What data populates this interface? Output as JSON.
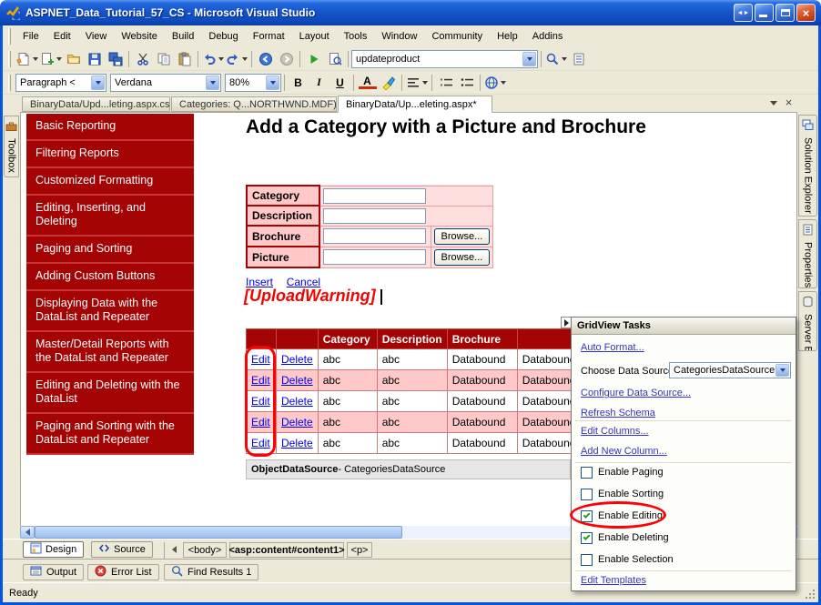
{
  "window": {
    "title": "ASPNET_Data_Tutorial_57_CS - Microsoft Visual Studio",
    "status": "Ready"
  },
  "icons": {
    "close": "×",
    "window_arrows": "◄►"
  },
  "menu": {
    "items": [
      "File",
      "Edit",
      "View",
      "Website",
      "Build",
      "Debug",
      "Format",
      "Layout",
      "Tools",
      "Window",
      "Community",
      "Help",
      "Addins"
    ]
  },
  "toolbars": {
    "address_combo": "updateproduct",
    "format_combo": "Paragraph <",
    "font_combo": "Verdana",
    "zoom_combo": "80%",
    "bold_label": "B",
    "italic_label": "I",
    "underline_label": "U",
    "fontcolor_label": "A"
  },
  "doc_tabs": {
    "tabs": [
      {
        "label": "BinaryData/Upd...leting.aspx.cs"
      },
      {
        "label": "Categories: Q...NORTHWND.MDF)"
      },
      {
        "label": "BinaryData/Up...eleting.aspx*"
      }
    ]
  },
  "side_tabs": {
    "left": "Toolbox",
    "right": [
      "Solution Explorer",
      "Properties",
      "Server E..."
    ]
  },
  "sidebar": {
    "items": [
      "Basic Reporting",
      "Filtering Reports",
      "Customized Formatting",
      "Editing, Inserting, and Deleting",
      "Paging and Sorting",
      "Adding Custom Buttons",
      "Displaying Data with the DataList and Repeater",
      "Master/Detail Reports with the DataList and Repeater",
      "Editing and Deleting with the DataList",
      "Paging and Sorting with the DataList and Repeater"
    ]
  },
  "content": {
    "heading": "Add a Category with a Picture and Brochure",
    "form": {
      "rows": [
        {
          "label": "Category"
        },
        {
          "label": "Description"
        },
        {
          "label": "Brochure"
        },
        {
          "label": "Picture"
        }
      ],
      "browse_button": "Browse..."
    },
    "insert_link": "Insert",
    "cancel_link": "Cancel",
    "upload_warning": "[UploadWarning]",
    "grid": {
      "headers": [
        "",
        "",
        "Category",
        "Description",
        "Brochure",
        ""
      ],
      "rows": [
        [
          "Edit",
          "Delete",
          "abc",
          "abc",
          "Databound",
          "Databound"
        ],
        [
          "Edit",
          "Delete",
          "abc",
          "abc",
          "Databound",
          "Databound"
        ],
        [
          "Edit",
          "Delete",
          "abc",
          "abc",
          "Databound",
          "Databound"
        ],
        [
          "Edit",
          "Delete",
          "abc",
          "abc",
          "Databound",
          "Databound"
        ],
        [
          "Edit",
          "Delete",
          "abc",
          "abc",
          "Databound",
          "Databound"
        ]
      ]
    },
    "datasource": {
      "name": "ObjectDataSource",
      "suffix": " - CategoriesDataSource"
    }
  },
  "tasks": {
    "title": "GridView Tasks",
    "auto_format": "Auto Format...",
    "choose_label": "Choose Data Source:",
    "choose_value": "CategoriesDataSource",
    "configure": "Configure Data Source...",
    "refresh": "Refresh Schema",
    "edit_columns": "Edit Columns...",
    "add_column": "Add New Column...",
    "checkboxes": [
      {
        "label": "Enable Paging",
        "checked": false
      },
      {
        "label": "Enable Sorting",
        "checked": false
      },
      {
        "label": "Enable Editing",
        "checked": true
      },
      {
        "label": "Enable Deleting",
        "checked": true
      },
      {
        "label": "Enable Selection",
        "checked": false
      }
    ],
    "edit_templates": "Edit Templates"
  },
  "bottom": {
    "design": "Design",
    "source": "Source",
    "tags": [
      "<body>",
      "<asp:content#content1>",
      "<p>"
    ],
    "panels": [
      "Output",
      "Error List",
      "Find Results 1"
    ]
  }
}
